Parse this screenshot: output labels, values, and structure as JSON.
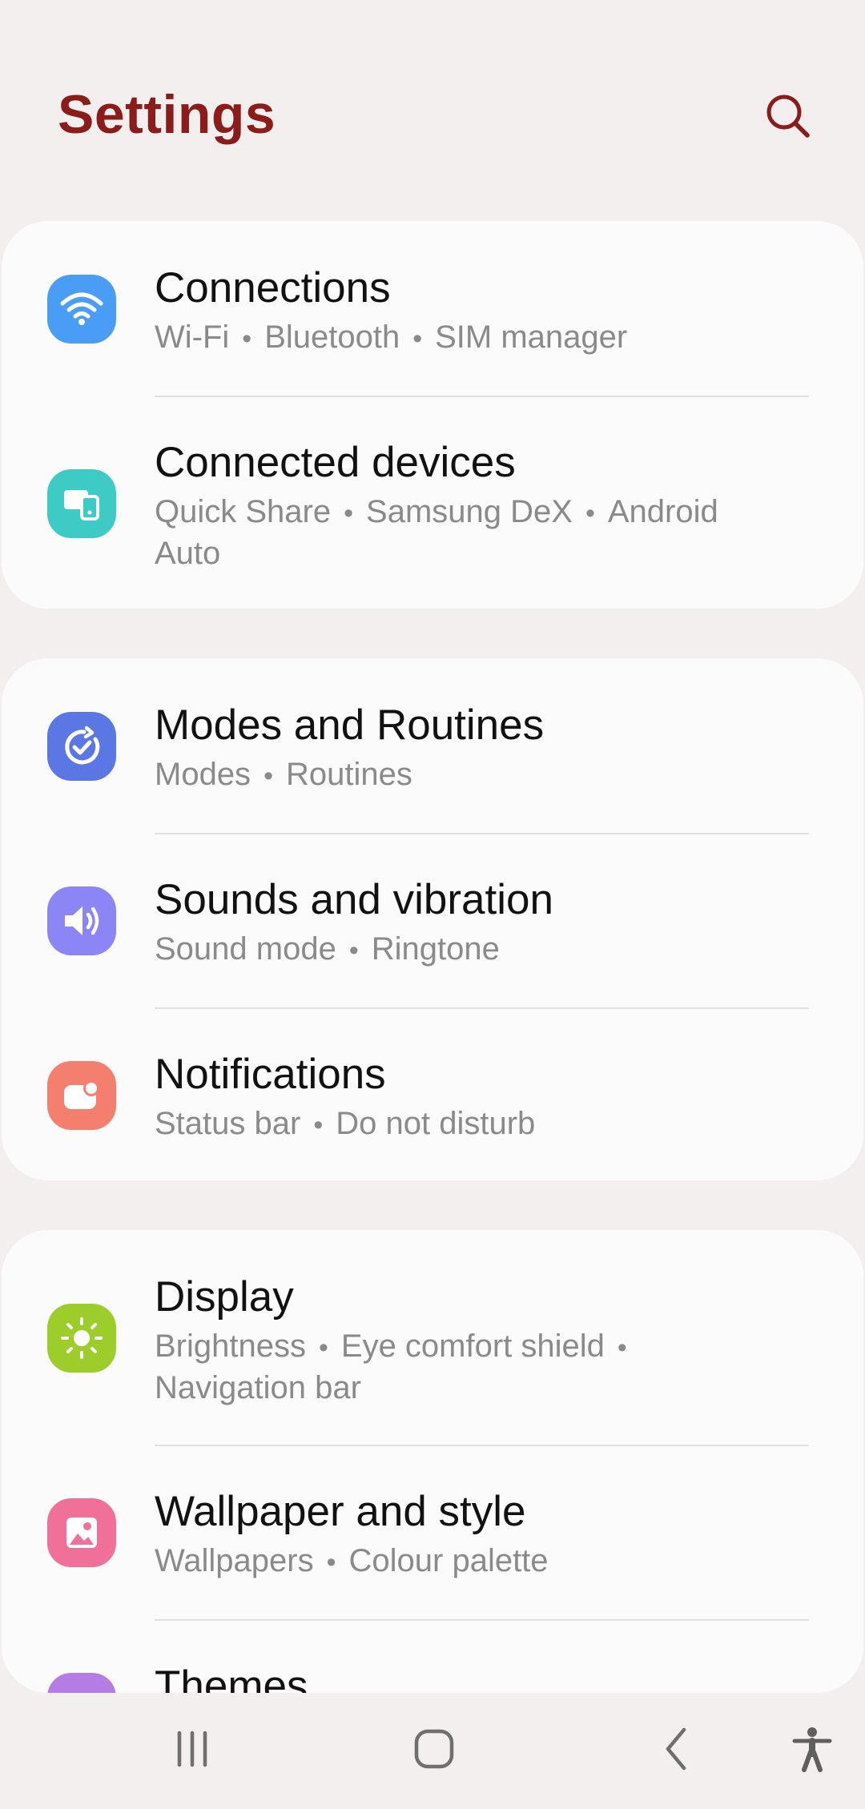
{
  "header": {
    "title": "Settings",
    "search_icon": "search-icon",
    "title_color": "#8a1c1c"
  },
  "groups": [
    {
      "items": [
        {
          "title": "Connections",
          "subtitle": [
            "Wi-Fi",
            "Bluetooth",
            "SIM manager"
          ],
          "icon": "wifi-icon",
          "icon_color": "#4a9df5"
        },
        {
          "title": "Connected devices",
          "subtitle": [
            "Quick Share",
            "Samsung DeX",
            "Android Auto"
          ],
          "icon": "connected-devices-icon",
          "icon_color": "#3ecbc5"
        }
      ]
    },
    {
      "items": [
        {
          "title": "Modes and Routines",
          "subtitle": [
            "Modes",
            "Routines"
          ],
          "icon": "modes-routines-icon",
          "icon_color": "#5a77e3"
        },
        {
          "title": "Sounds and vibration",
          "subtitle": [
            "Sound mode",
            "Ringtone"
          ],
          "icon": "sound-icon",
          "icon_color": "#8c85f5"
        },
        {
          "title": "Notifications",
          "subtitle": [
            "Status bar",
            "Do not disturb"
          ],
          "icon": "notifications-icon",
          "icon_color": "#f47f6f"
        }
      ]
    },
    {
      "items": [
        {
          "title": "Display",
          "subtitle": [
            "Brightness",
            "Eye comfort shield",
            "Navigation bar"
          ],
          "icon": "display-brightness-icon",
          "icon_color": "#9ccd2a"
        },
        {
          "title": "Wallpaper and style",
          "subtitle": [
            "Wallpapers",
            "Colour palette"
          ],
          "icon": "wallpaper-icon",
          "icon_color": "#f0709a"
        },
        {
          "title": "Themes",
          "subtitle": [],
          "icon": "themes-icon",
          "icon_color": "#b57ce6"
        }
      ]
    }
  ],
  "navbar": {
    "recents_icon": "recents-icon",
    "home_icon": "home-icon",
    "back_icon": "back-icon",
    "accessibility_icon": "accessibility-icon"
  }
}
